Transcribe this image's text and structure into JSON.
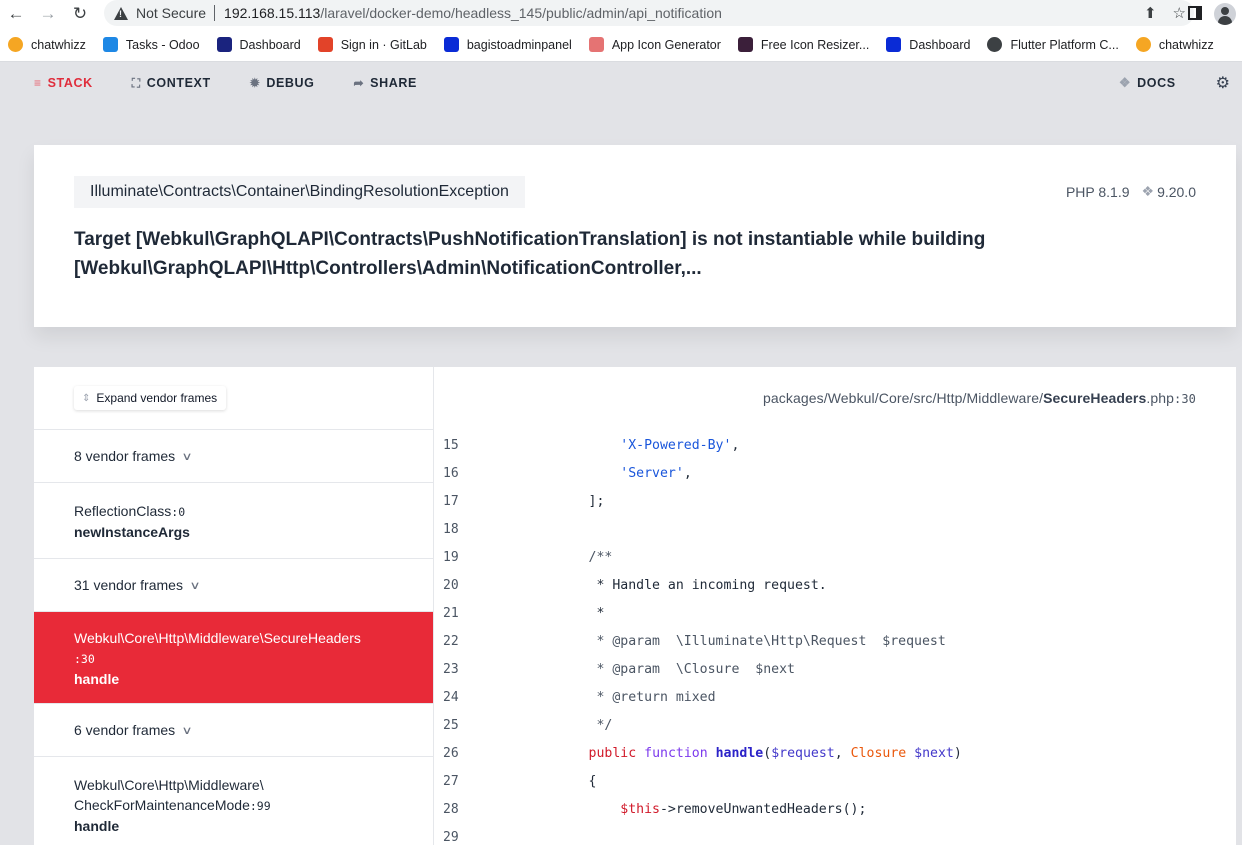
{
  "browser": {
    "security_label": "Not Secure",
    "url_host": "192.168.15.113",
    "url_path": "/laravel/docker-demo/headless_145/public/admin/api_notification",
    "bookmarks": [
      {
        "label": "chatwhizz",
        "icon": "chatwhizz-icon",
        "color": "#f5a623"
      },
      {
        "label": "Tasks - Odoo",
        "icon": "odoo-tasks-icon",
        "color": "#1e88e5"
      },
      {
        "label": "Dashboard",
        "icon": "dashboard-m-icon",
        "color": "#1a237e"
      },
      {
        "label": "Sign in · GitLab",
        "icon": "gitlab-icon",
        "color": "#e24329"
      },
      {
        "label": "bagistoadminpanel",
        "icon": "bag-icon",
        "color": "#0a2bd6"
      },
      {
        "label": "App Icon Generator",
        "icon": "grid-icon",
        "color": "#e57373"
      },
      {
        "label": "Free Icon Resizer...",
        "icon": "resizer-icon",
        "color": "#3b1f3a"
      },
      {
        "label": "Dashboard",
        "icon": "bag-icon",
        "color": "#0a2bd6"
      },
      {
        "label": "Flutter Platform C...",
        "icon": "globe-icon",
        "color": "#3c4043"
      },
      {
        "label": "chatwhizz",
        "icon": "chatwhizz-icon",
        "color": "#f5a623"
      }
    ]
  },
  "nav": {
    "tabs": [
      {
        "label": "STACK",
        "icon": "stack-icon",
        "active": true
      },
      {
        "label": "CONTEXT",
        "icon": "context-icon",
        "active": false
      },
      {
        "label": "DEBUG",
        "icon": "bug-icon",
        "active": false
      },
      {
        "label": "SHARE",
        "icon": "share-icon",
        "active": false
      }
    ],
    "docs_label": "DOCS"
  },
  "exception": {
    "class": "Illuminate\\Contracts\\Container\\BindingResolutionException",
    "php_version": "PHP 8.1.9",
    "laravel_version": "9.20.0",
    "message": "Target [Webkul\\GraphQLAPI\\Contracts\\PushNotificationTranslation] is not instantiable while building [Webkul\\GraphQLAPI\\Http\\Controllers\\Admin\\NotificationController,..."
  },
  "stack": {
    "expand_label": "Expand vendor frames",
    "frames": [
      {
        "type": "vendor",
        "label": "8 vendor frames"
      },
      {
        "type": "frame",
        "class": "ReflectionClass",
        "line": "0",
        "method": "newInstanceArgs"
      },
      {
        "type": "vendor",
        "label": "31 vendor frames"
      },
      {
        "type": "frame",
        "class": "Webkul\\Core\\Http\\Middleware\\SecureHeaders",
        "line": "30",
        "method": "handle",
        "selected": true
      },
      {
        "type": "vendor",
        "label": "6 vendor frames"
      },
      {
        "type": "frame",
        "class": "Webkul\\Core\\Http\\Middleware\\CheckForMaintenanceMode",
        "line": "99",
        "method": "handle"
      }
    ]
  },
  "code": {
    "path_prefix": "packages/Webkul/Core/src/Http/Middleware/",
    "file": "SecureHeaders",
    "ext": ".php",
    "line": "30",
    "lines": [
      {
        "n": "15",
        "tokens": [
          [
            "",
            "            "
          ],
          [
            "str",
            "'X-Powered-By'"
          ],
          [
            "",
            ","
          ]
        ]
      },
      {
        "n": "16",
        "tokens": [
          [
            "",
            "            "
          ],
          [
            "str",
            "'Server'"
          ],
          [
            "",
            ","
          ]
        ]
      },
      {
        "n": "17",
        "tokens": [
          [
            "",
            "        ];"
          ]
        ]
      },
      {
        "n": "18",
        "tokens": []
      },
      {
        "n": "19",
        "tokens": [
          [
            "",
            "        "
          ],
          [
            "com",
            "/**"
          ]
        ]
      },
      {
        "n": "20",
        "tokens": [
          [
            "",
            "         * Handle an incoming request."
          ]
        ]
      },
      {
        "n": "21",
        "tokens": [
          [
            "",
            "         *"
          ]
        ]
      },
      {
        "n": "22",
        "tokens": [
          [
            "",
            "         "
          ],
          [
            "com",
            "* @param  \\Illuminate\\Http\\Request  $request"
          ]
        ]
      },
      {
        "n": "23",
        "tokens": [
          [
            "",
            "         "
          ],
          [
            "com",
            "* @param  \\Closure  $next"
          ]
        ]
      },
      {
        "n": "24",
        "tokens": [
          [
            "",
            "         "
          ],
          [
            "com",
            "* @return mixed"
          ]
        ]
      },
      {
        "n": "25",
        "tokens": [
          [
            "",
            "         "
          ],
          [
            "com",
            "*/"
          ]
        ]
      },
      {
        "n": "26",
        "tokens": [
          [
            "",
            "        "
          ],
          [
            "kw",
            "public"
          ],
          [
            "",
            " "
          ],
          [
            "fnkw",
            "function"
          ],
          [
            "",
            " "
          ],
          [
            "name",
            "handle"
          ],
          [
            "",
            "("
          ],
          [
            "var",
            "$request"
          ],
          [
            "",
            ", "
          ],
          [
            "cls",
            "Closure"
          ],
          [
            "",
            " "
          ],
          [
            "var",
            "$next"
          ],
          [
            "",
            ")"
          ]
        ]
      },
      {
        "n": "27",
        "tokens": [
          [
            "",
            "        {"
          ]
        ]
      },
      {
        "n": "28",
        "tokens": [
          [
            "",
            "            "
          ],
          [
            "this",
            "$this"
          ],
          [
            "",
            "->removeUnwantedHeaders();"
          ]
        ]
      },
      {
        "n": "29",
        "tokens": []
      }
    ]
  }
}
